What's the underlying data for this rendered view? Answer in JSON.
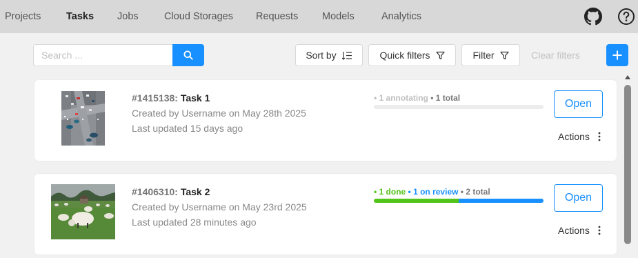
{
  "nav": {
    "items": [
      {
        "label": "Projects",
        "active": false
      },
      {
        "label": "Tasks",
        "active": true
      },
      {
        "label": "Jobs",
        "active": false
      },
      {
        "label": "Cloud Storages",
        "active": false
      },
      {
        "label": "Requests",
        "active": false
      },
      {
        "label": "Models",
        "active": false
      },
      {
        "label": "Analytics",
        "active": false
      }
    ],
    "icons": [
      "github-icon",
      "help-icon"
    ]
  },
  "toolbar": {
    "search_placeholder": "Search ...",
    "sort_label": "Sort by",
    "quick_filters_label": "Quick filters",
    "filter_label": "Filter",
    "clear_filters_label": "Clear filters"
  },
  "tasks": [
    {
      "id": "#1415138:",
      "name": "Task 1",
      "created": "Created by Username on May 28th 2025",
      "updated": "Last updated 15 days ago",
      "progress": {
        "segments": [
          {
            "text": "• 1 annotating",
            "color": "#bfbfbf"
          },
          {
            "text": " • 1 total",
            "color": "#777777"
          }
        ],
        "bar": [
          {
            "fraction": 1.0,
            "color": "#ececec"
          }
        ]
      },
      "open_label": "Open",
      "actions_label": "Actions"
    },
    {
      "id": "#1406310:",
      "name": "Task 2",
      "created": "Created by Username on May 23rd 2025",
      "updated": "Last updated 28 minutes ago",
      "progress": {
        "segments": [
          {
            "text": "• 1 done",
            "color": "#52c41a"
          },
          {
            "text": " • 1 on review",
            "color": "#1890ff"
          },
          {
            "text": " • 2 total",
            "color": "#777777"
          }
        ],
        "bar": [
          {
            "fraction": 0.5,
            "color": "#52c41a"
          },
          {
            "fraction": 0.5,
            "color": "#1890ff"
          }
        ]
      },
      "open_label": "Open",
      "actions_label": "Actions"
    }
  ],
  "colors": {
    "accent": "#1890ff",
    "done": "#52c41a",
    "nav_bg": "#d8d8d8",
    "page_bg": "#f1f1f1"
  }
}
